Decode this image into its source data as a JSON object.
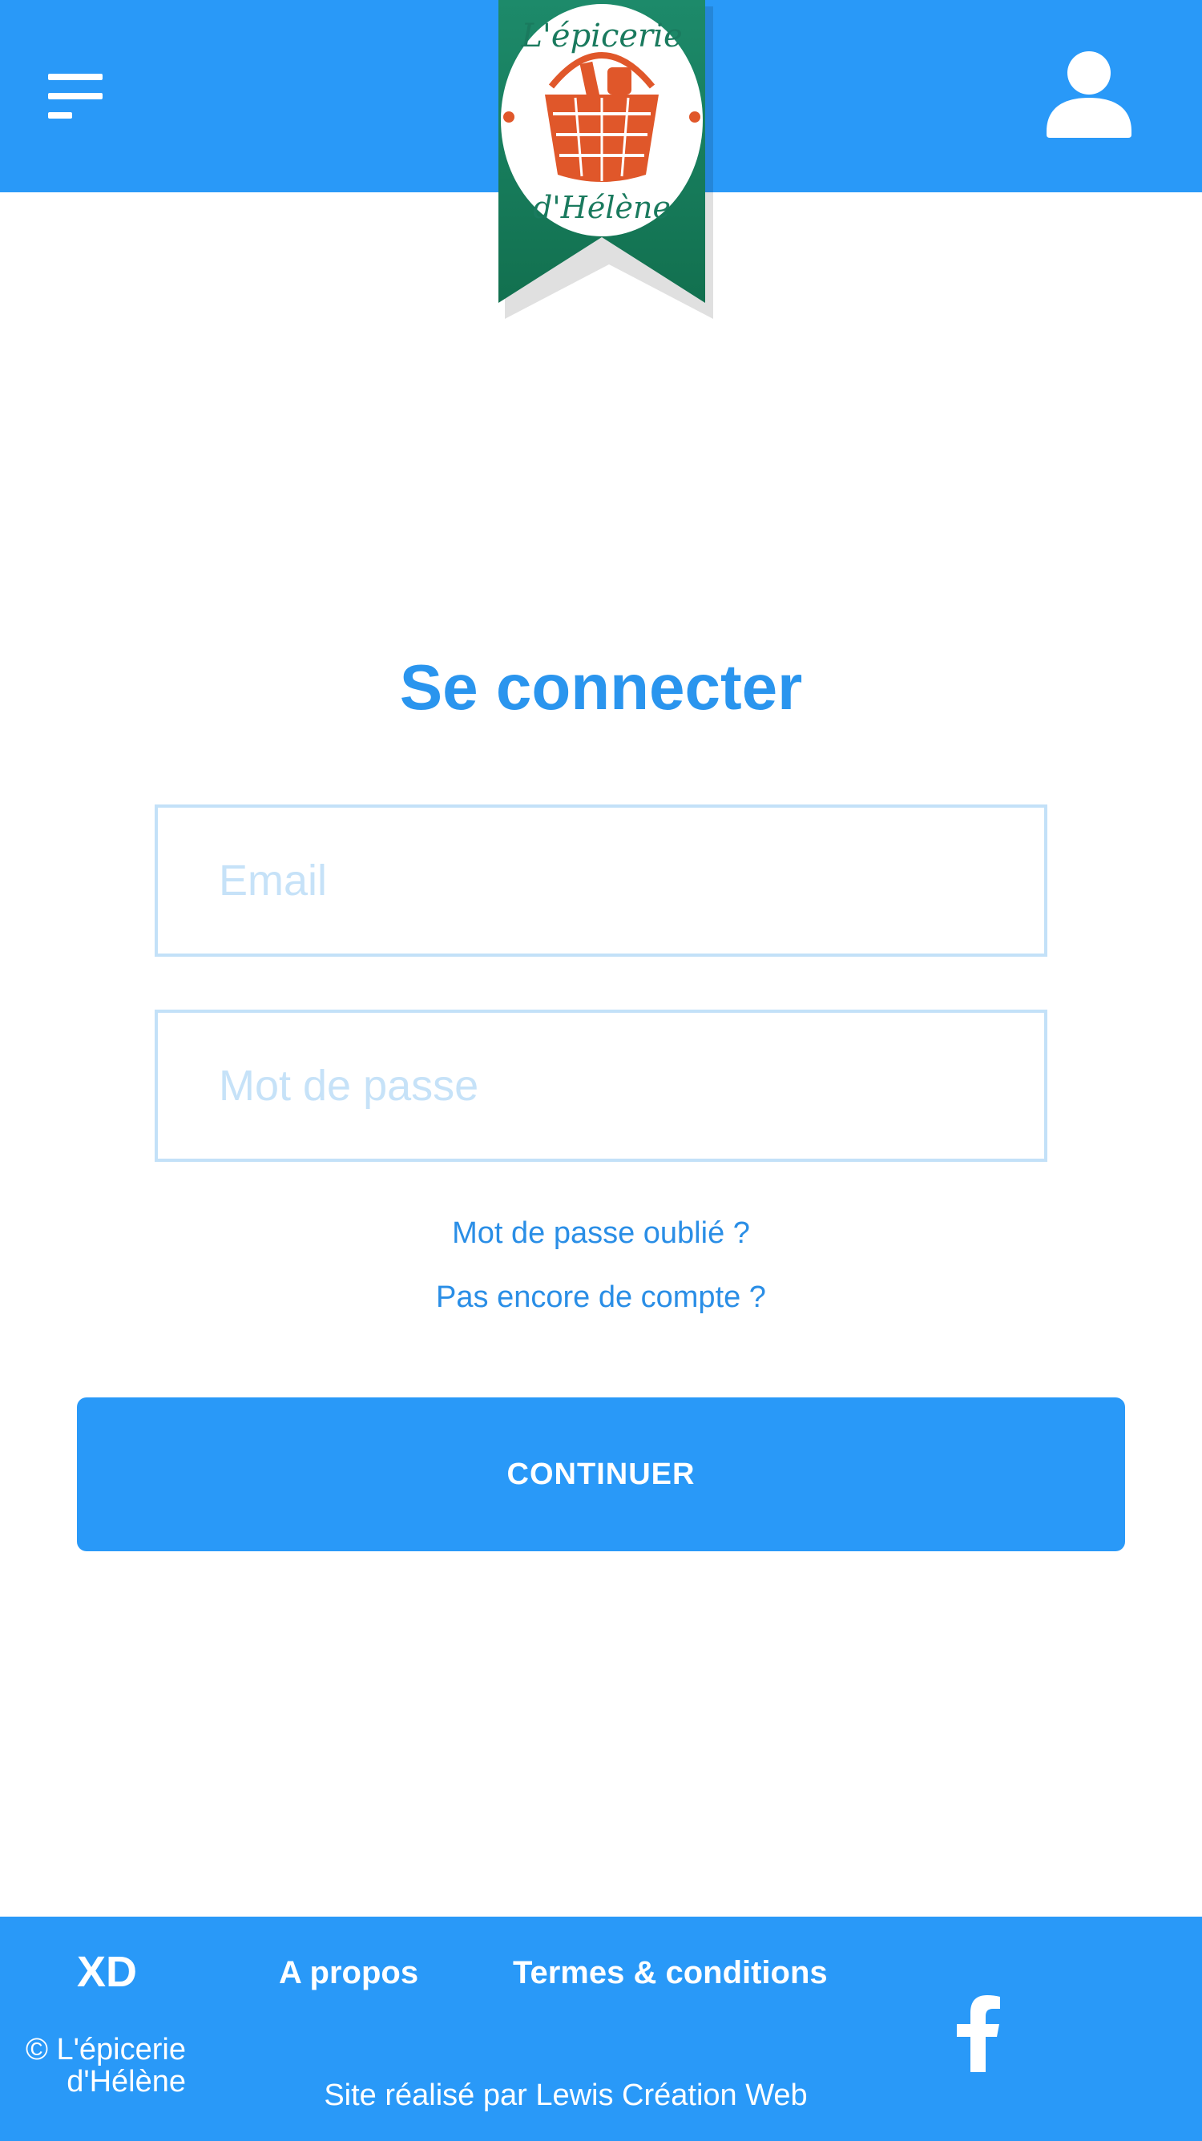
{
  "header": {
    "menu_icon": "menu-icon",
    "user_icon": "user-icon",
    "logo": {
      "line1": "L'épicerie",
      "line2": "d'Hélène",
      "emblem": "basket-icon",
      "colors": {
        "ribbon": "#1a7a5e",
        "basket": "#e0572a"
      }
    }
  },
  "login": {
    "title": "Se connecter",
    "email_placeholder": "Email",
    "email_value": "",
    "password_placeholder": "Mot de passe",
    "password_value": "",
    "forgot_link": "Mot de passe oublié ?",
    "signup_link": "Pas encore de compte ?",
    "submit_label": "CONTINUER"
  },
  "footer": {
    "brand": "XD",
    "about_link": "A propos",
    "terms_link": "Termes & conditions",
    "copyright_line1": "© L'épicerie",
    "copyright_line2": "d'Hélène",
    "credit": "Site réalisé par Lewis Création Web",
    "social_icon": "facebook-icon"
  },
  "colors": {
    "primary": "#2999f8",
    "title": "#2a95ee",
    "link": "#2a8ee6",
    "input_border": "#c3e1f8",
    "placeholder": "#c6e2f8"
  }
}
